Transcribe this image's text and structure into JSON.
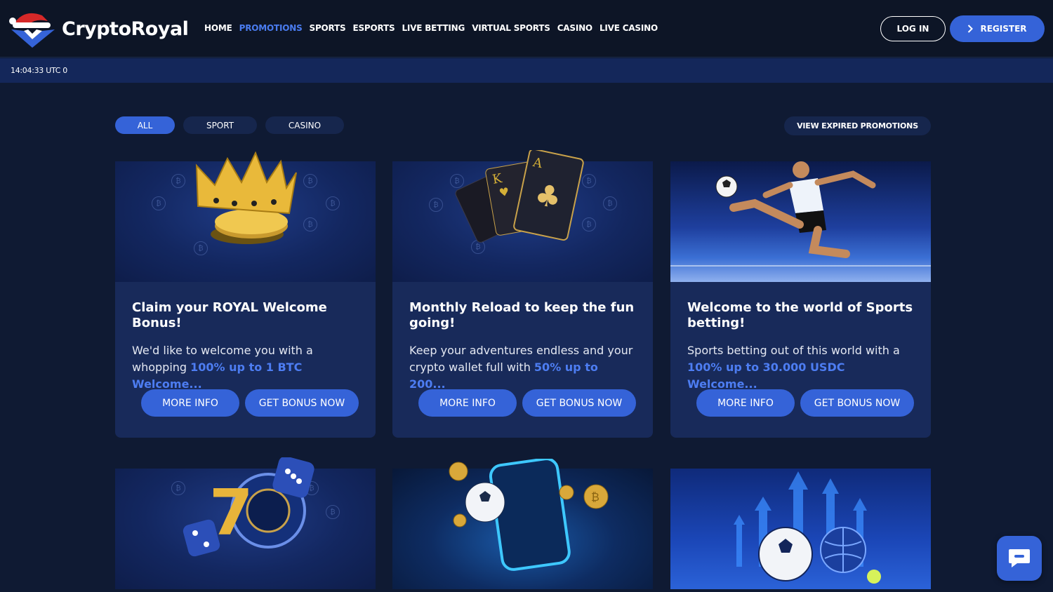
{
  "brand": {
    "name": "CryptoRoyal",
    "accent": "#3563d8",
    "highlight": "#4d7df2"
  },
  "nav": {
    "items": [
      {
        "label": "HOME",
        "active": false
      },
      {
        "label": "PROMOTIONS",
        "active": true
      },
      {
        "label": "SPORTS",
        "active": false
      },
      {
        "label": "ESPORTS",
        "active": false
      },
      {
        "label": "LIVE BETTING",
        "active": false
      },
      {
        "label": "VIRTUAL SPORTS",
        "active": false
      },
      {
        "label": "CASINO",
        "active": false
      },
      {
        "label": "LIVE CASINO",
        "active": false
      }
    ],
    "login_label": "LOG IN",
    "register_label": "REGISTER"
  },
  "status": {
    "time": "14:04:33 UTC 0"
  },
  "filters": {
    "items": [
      {
        "label": "ALL",
        "active": true
      },
      {
        "label": "SPORT",
        "active": false
      },
      {
        "label": "CASINO",
        "active": false
      }
    ],
    "expired_label": "VIEW EXPIRED PROMOTIONS"
  },
  "promotions": [
    {
      "title": "Claim your ROYAL Welcome Bonus!",
      "text_plain": "We'd like to welcome you with a whopping ",
      "text_highlight": "100% up to 1 BTC Welcome...",
      "image": "crown-coins",
      "more_info": "MORE INFO",
      "get_bonus": "GET BONUS NOW"
    },
    {
      "title": "Monthly Reload to keep the fun going!",
      "text_plain": "Keep your adventures endless and your crypto wallet full with ",
      "text_highlight": "50% up to 200...",
      "image": "playing-cards",
      "more_info": "MORE INFO",
      "get_bonus": "GET BONUS NOW"
    },
    {
      "title": "Welcome to the world of Sports betting!",
      "text_plain": "Sports betting out of this world with a ",
      "text_highlight": "100% up to 30.000 USDC Welcome...",
      "image": "football-player",
      "more_info": "MORE INFO",
      "get_bonus": "GET BONUS NOW"
    },
    {
      "image": "slot-roulette-dice"
    },
    {
      "image": "phone-football-coins"
    },
    {
      "image": "balls-arrows"
    }
  ]
}
